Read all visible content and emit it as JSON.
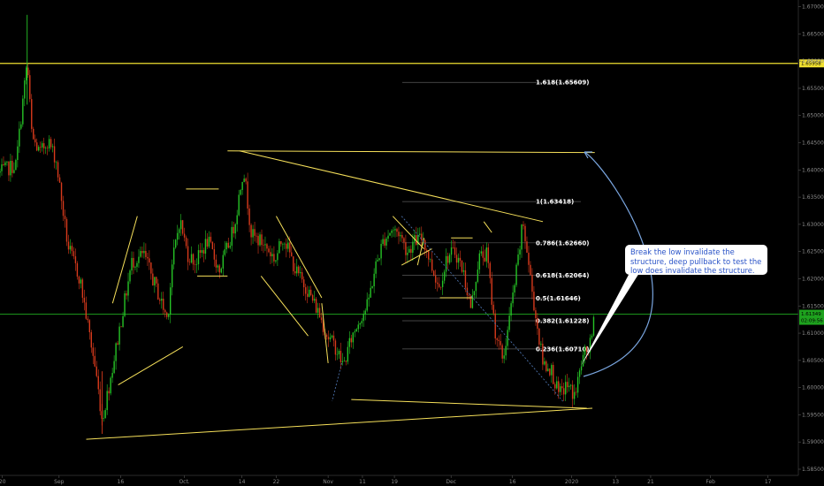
{
  "chart_data": {
    "type": "candlestick",
    "title": "",
    "xlabel": "",
    "ylabel": "",
    "ylim": [
      1.585,
      1.6705
    ],
    "y_ticks": [
      "1.67000",
      "1.66500",
      "1.66000",
      "1.65500",
      "1.65000",
      "1.64500",
      "1.64000",
      "1.63500",
      "1.63000",
      "1.62500",
      "1.62000",
      "1.61500",
      "1.61000",
      "1.60500",
      "1.60000",
      "1.59500",
      "1.59000",
      "1.58500"
    ],
    "x_ticks": [
      "20",
      "Sep",
      "16",
      "Oct.",
      "14",
      "22",
      "Nov",
      "11",
      "19",
      "Dec",
      "16",
      "2020",
      "13",
      "21",
      "Feb",
      "17"
    ],
    "x_tick_frac": [
      0.003,
      0.074,
      0.151,
      0.231,
      0.303,
      0.346,
      0.411,
      0.454,
      0.494,
      0.565,
      0.642,
      0.716,
      0.771,
      0.815,
      0.89,
      0.962
    ],
    "price_path": [
      [
        0.0,
        1.6395
      ],
      [
        0.02,
        1.641
      ],
      [
        0.034,
        1.66
      ],
      [
        0.04,
        1.646
      ],
      [
        0.05,
        1.643
      ],
      [
        0.06,
        1.6455
      ],
      [
        0.07,
        1.642
      ],
      [
        0.085,
        1.626
      ],
      [
        0.1,
        1.62
      ],
      [
        0.12,
        1.603
      ],
      [
        0.128,
        1.594
      ],
      [
        0.14,
        1.603
      ],
      [
        0.15,
        1.611
      ],
      [
        0.165,
        1.623
      ],
      [
        0.18,
        1.6245
      ],
      [
        0.2,
        1.6165
      ],
      [
        0.21,
        1.6125
      ],
      [
        0.215,
        1.622
      ],
      [
        0.225,
        1.631
      ],
      [
        0.235,
        1.6245
      ],
      [
        0.245,
        1.623
      ],
      [
        0.26,
        1.627
      ],
      [
        0.275,
        1.6215
      ],
      [
        0.29,
        1.628
      ],
      [
        0.295,
        1.631
      ],
      [
        0.305,
        1.6405
      ],
      [
        0.315,
        1.628
      ],
      [
        0.33,
        1.6265
      ],
      [
        0.345,
        1.6235
      ],
      [
        0.355,
        1.628
      ],
      [
        0.37,
        1.6215
      ],
      [
        0.385,
        1.618
      ],
      [
        0.4,
        1.6135
      ],
      [
        0.41,
        1.6095
      ],
      [
        0.42,
        1.6075
      ],
      [
        0.43,
        1.604
      ],
      [
        0.44,
        1.609
      ],
      [
        0.45,
        1.6125
      ],
      [
        0.46,
        1.615
      ],
      [
        0.47,
        1.622
      ],
      [
        0.48,
        1.627
      ],
      [
        0.49,
        1.629
      ],
      [
        0.5,
        1.6285
      ],
      [
        0.51,
        1.625
      ],
      [
        0.52,
        1.627
      ],
      [
        0.53,
        1.6275
      ],
      [
        0.54,
        1.6225
      ],
      [
        0.55,
        1.6185
      ],
      [
        0.56,
        1.624
      ],
      [
        0.57,
        1.625
      ],
      [
        0.58,
        1.6215
      ],
      [
        0.59,
        1.6145
      ],
      [
        0.6,
        1.624
      ],
      [
        0.61,
        1.6245
      ],
      [
        0.62,
        1.6105
      ],
      [
        0.63,
        1.605
      ],
      [
        0.64,
        1.6145
      ],
      [
        0.65,
        1.6245
      ],
      [
        0.655,
        1.6305
      ],
      [
        0.66,
        1.625
      ],
      [
        0.67,
        1.614
      ],
      [
        0.68,
        1.6045
      ],
      [
        0.69,
        1.6035
      ],
      [
        0.7,
        1.5985
      ],
      [
        0.71,
        1.6005
      ],
      [
        0.72,
        1.5985
      ],
      [
        0.73,
        1.6055
      ],
      [
        0.74,
        1.608
      ],
      [
        0.745,
        1.6135
      ]
    ],
    "horizontal_level": 1.65958,
    "current_price": 1.61349,
    "countdown": "02:09:56",
    "fibonacci": [
      {
        "label": "1.618(1.65609)",
        "price": 1.65609
      },
      {
        "label": "1(1.63418)",
        "price": 1.63418
      },
      {
        "label": "0.786(1.62660)",
        "price": 1.6266
      },
      {
        "label": "0.618(1.62064)",
        "price": 1.62064
      },
      {
        "label": "0.5(1.61646)",
        "price": 1.61646
      },
      {
        "label": "0.382(1.61228)",
        "price": 1.61228
      },
      {
        "label": "0.236(1.60710)",
        "price": 1.6071
      }
    ],
    "trendlines": [
      {
        "from": [
          0.108,
          1.5905
        ],
        "to": [
          0.742,
          1.5962
        ]
      },
      {
        "from": [
          0.285,
          1.6435
        ],
        "to": [
          0.745,
          1.6432
        ]
      },
      {
        "from": [
          0.3,
          1.6435
        ],
        "to": [
          0.68,
          1.6305
        ]
      },
      {
        "from": [
          0.44,
          1.5978
        ],
        "to": [
          0.735,
          1.5962
        ]
      }
    ],
    "annotation": "Break the low invalidate the structure, deep pullback to test the low does invalidate the structure."
  },
  "price_labels": {
    "horizontal_level": "1.65958",
    "current_price": "1.61349",
    "countdown": "02:09:56"
  },
  "callout": {
    "text": "Break the low invalidate the structure, deep pullback to test the low does invalidate the structure."
  },
  "colors": {
    "background": "#000000",
    "up_candle": "#26c426",
    "down_candle": "#d83a1c",
    "drawing": "#f6e05a",
    "level_line": "#f0e030",
    "current_line": "#1faa1f",
    "fib_line": "#5a5a5a",
    "arrow": "#7aa6e0",
    "callout_text": "#2b54c8"
  }
}
